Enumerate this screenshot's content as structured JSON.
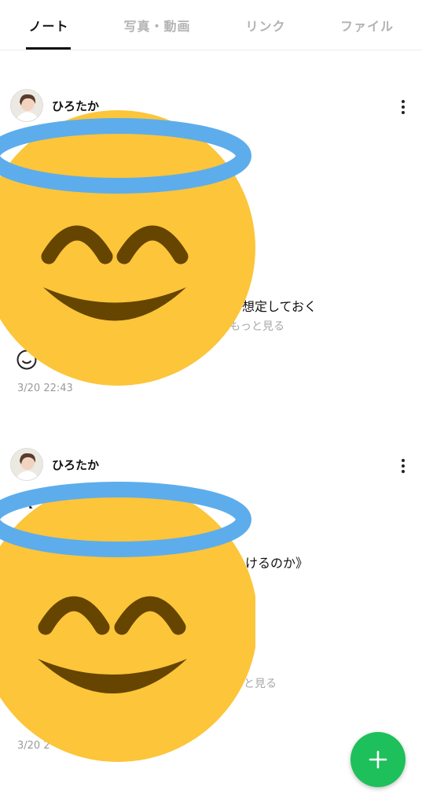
{
  "tabs": [
    {
      "label": "ノート",
      "active": true
    },
    {
      "label": "写真・動画",
      "active": false
    },
    {
      "label": "リンク",
      "active": false
    },
    {
      "label": "ファイル",
      "active": false
    }
  ],
  "posts": [
    {
      "author": "ひろたか",
      "visible_text": "を想定しておく",
      "see_more": "もっと見る",
      "timestamp": "3/20 22:43",
      "fragment": "【"
    },
    {
      "author": "ひろたか",
      "visible_text": "いけるのか》",
      "see_more": "と見る",
      "timestamp": "3/20 2",
      "fragment": "【"
    }
  ],
  "overlay_emoji": "smiling-face-with-halo",
  "fab": {
    "icon": "plus-icon",
    "color": "#1dc05a"
  },
  "colors": {
    "accent": "#1dc05a",
    "emoji_face": "#fcc53a",
    "emoji_halo": "#5dadec",
    "emoji_feature": "#664500"
  }
}
